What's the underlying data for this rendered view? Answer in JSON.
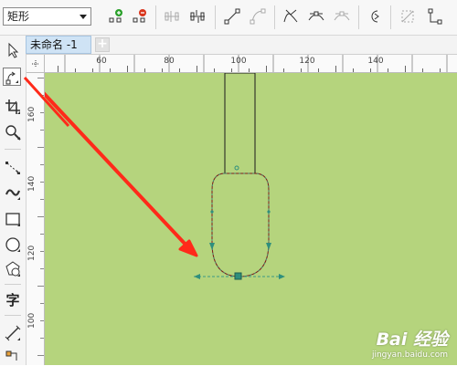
{
  "property_bar": {
    "shape_select_value": "矩形",
    "buttons": [
      "add-node-icon",
      "delete-node-icon",
      "join-nodes-icon",
      "break-curve-icon",
      "to-line-icon",
      "to-curve-icon",
      "cusp-node-icon",
      "smooth-node-icon",
      "symmetrical-node-icon",
      "reverse-direction-icon",
      "extract-subpath-icon",
      "extend-curve-icon"
    ]
  },
  "document": {
    "tab_title": "未命名 -1",
    "new_tab_glyph": "+"
  },
  "toolbox": {
    "tools": [
      "pick-tool-icon",
      "shape-tool-icon",
      "crop-tool-icon",
      "zoom-tool-icon",
      "freehand-tool-icon",
      "artistic-media-icon",
      "rectangle-tool-icon",
      "ellipse-tool-icon",
      "polygon-tool-icon",
      "text-tool-icon",
      "parallel-dimension-icon",
      "connector-tool-icon"
    ],
    "text_tool_glyph": "字"
  },
  "rulers": {
    "horizontal_labels": [
      "60",
      "80",
      "100",
      "120",
      "140"
    ],
    "vertical_labels": [
      "160",
      "140",
      "120",
      "100"
    ]
  },
  "colors": {
    "canvas_background": "#b5d47d",
    "arrow": "#ff2a1a",
    "node_handle": "#3a9a85",
    "outline": "#1a1a1a"
  },
  "watermark": {
    "logo_text": "Bai 经验",
    "url": "jingyan.baidu.com"
  }
}
